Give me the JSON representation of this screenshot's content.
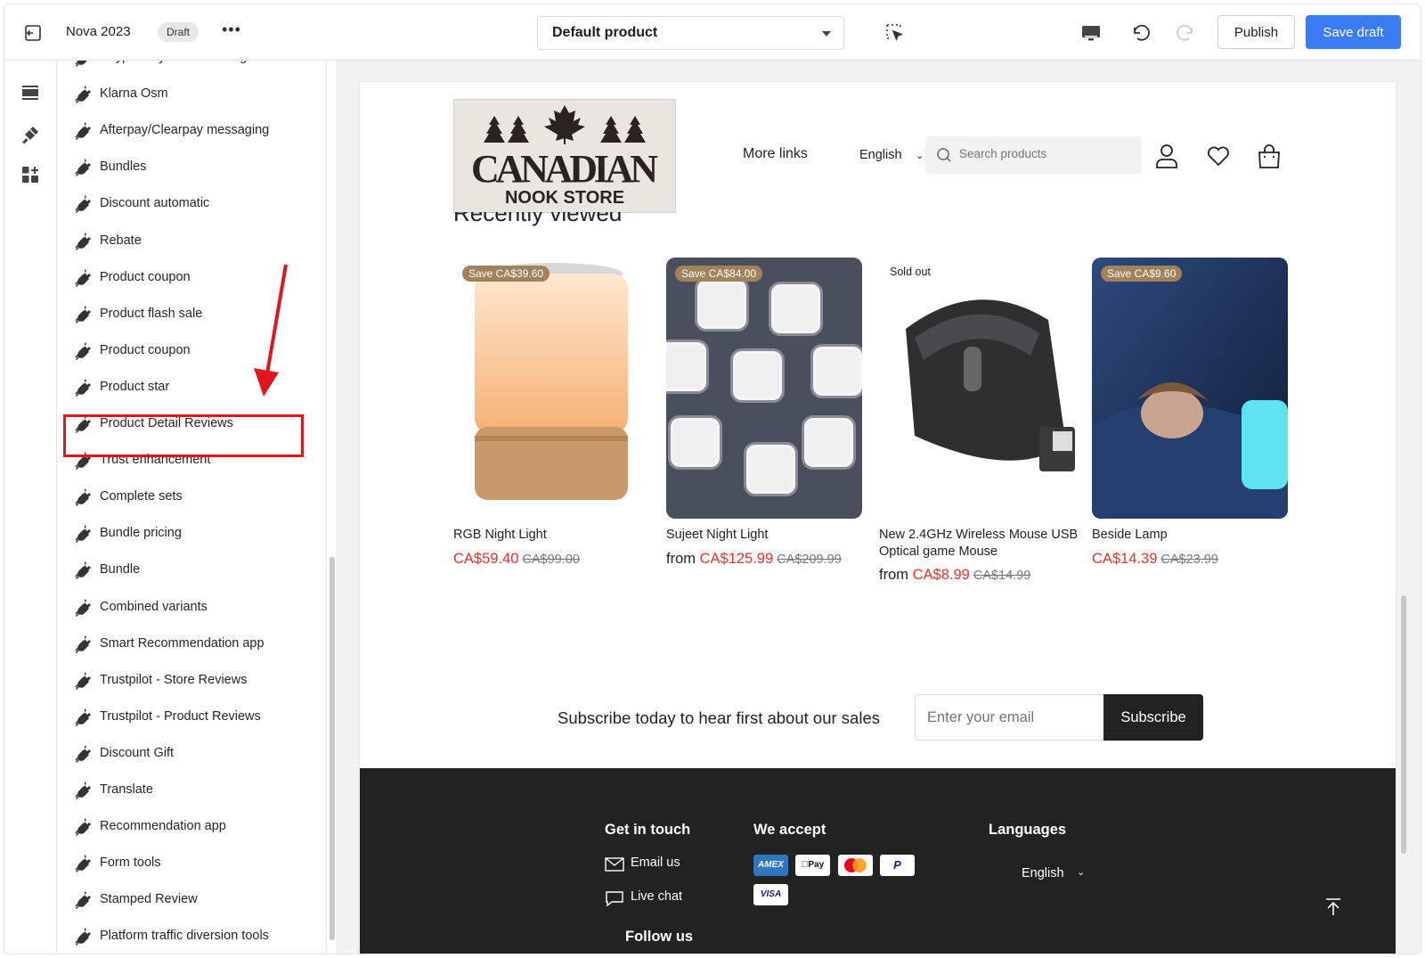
{
  "topbar": {
    "store_name": "Nova 2023",
    "status_badge": "Draft",
    "more": "•••",
    "template_select": "Default product",
    "publish_label": "Publish",
    "save_label": "Save draft",
    "accent": "#3b7cf4"
  },
  "sidebar": {
    "items": [
      {
        "label": "Paypal Pay Later Message"
      },
      {
        "label": "Klarna Osm"
      },
      {
        "label": "Afterpay/Clearpay messaging"
      },
      {
        "label": "Bundles"
      },
      {
        "label": "Discount automatic"
      },
      {
        "label": "Rebate"
      },
      {
        "label": "Product coupon"
      },
      {
        "label": "Product flash sale"
      },
      {
        "label": "Product coupon"
      },
      {
        "label": "Product star"
      },
      {
        "label": "Product Detail Reviews"
      },
      {
        "label": "Trust enhancement"
      },
      {
        "label": "Complete sets"
      },
      {
        "label": "Bundle pricing"
      },
      {
        "label": "Bundle"
      },
      {
        "label": "Combined variants"
      },
      {
        "label": "Smart Recommendation app"
      },
      {
        "label": "Trustpilot - Store Reviews"
      },
      {
        "label": "Trustpilot - Product Reviews"
      },
      {
        "label": "Discount Gift"
      },
      {
        "label": "Translate"
      },
      {
        "label": "Recommendation app"
      },
      {
        "label": "Form tools"
      },
      {
        "label": "Stamped Review"
      },
      {
        "label": "Platform traffic diversion tools"
      }
    ],
    "highlight_color": "#e0161c"
  },
  "store": {
    "logo_line1": "CANADIAN",
    "logo_line2": "NOOK STORE",
    "more_links": "More links",
    "language": "English",
    "search_placeholder": "Search products",
    "section_title": "Recently viewed"
  },
  "products": [
    {
      "badge": "Save CA$39.60",
      "title": "RGB Night Light",
      "from": "",
      "price": "CA$59.40",
      "compare": "CA$99.00"
    },
    {
      "badge": "Save CA$84.00",
      "title": "Sujeet Night Light",
      "from": "from ",
      "price": "CA$125.99",
      "compare": "CA$209.99"
    },
    {
      "badge": "Sold out",
      "title": "New 2.4GHz Wireless Mouse USB Optical game Mouse",
      "from": "from ",
      "price": "CA$8.99",
      "compare": "CA$14.99"
    },
    {
      "badge": "Save CA$9.60",
      "title": "Beside Lamp",
      "from": "",
      "price": "CA$14.39",
      "compare": "CA$23.99"
    }
  ],
  "subscribe": {
    "text": "Subscribe today to hear first about our sales",
    "placeholder": "Enter your email",
    "button": "Subscribe"
  },
  "footer": {
    "get_in_touch": "Get in touch",
    "email_us": "Email us",
    "live_chat": "Live chat",
    "we_accept": "We accept",
    "payments": [
      "AMEX",
      "Pay",
      "",
      "P",
      "VISA"
    ],
    "languages": "Languages",
    "language": "English",
    "follow_us": "Follow us"
  },
  "colors": {
    "sale_price": "#e4332c",
    "badge": "#a0825b",
    "footer_bg": "#222222"
  }
}
